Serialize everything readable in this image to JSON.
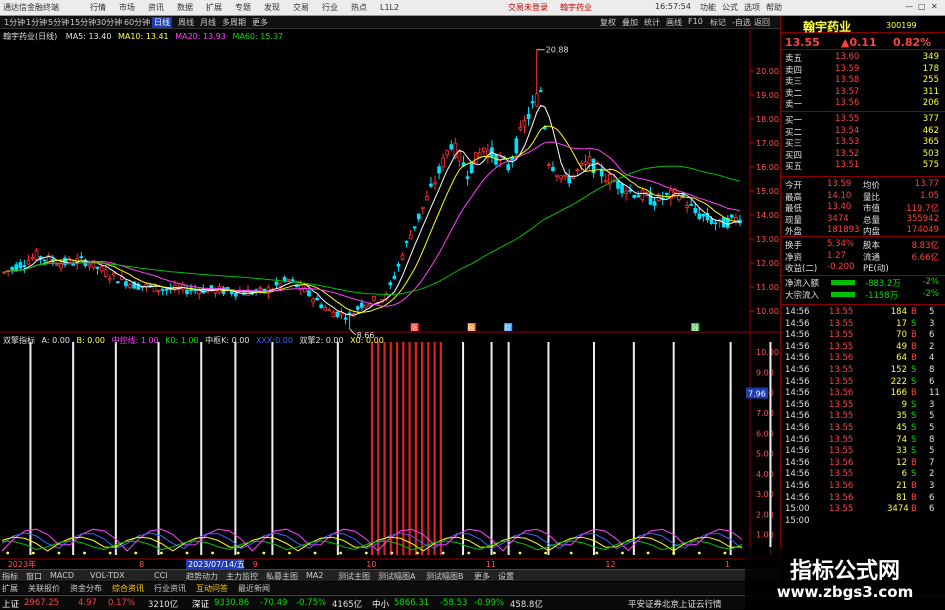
{
  "titlebar": {
    "app_title": "通达信金融终端",
    "menu": [
      "行情",
      "市场",
      "资讯",
      "数据",
      "扩展",
      "专题",
      "发现",
      "交易",
      "行业",
      "热点",
      "L1L2"
    ],
    "trade_links": "交易未登录",
    "stock_link": "翰宇药业",
    "clock": "16:57:54",
    "right_menu": [
      "功能",
      "公式",
      "选项",
      "帮助"
    ]
  },
  "toolbar": {
    "periods": [
      "1分钟",
      "1分钟",
      "5分钟",
      "15分钟",
      "30分钟",
      "60分钟",
      "日线",
      "周线",
      "月线",
      "多周期",
      "更多"
    ],
    "active": "日线",
    "right_items": [
      "复权",
      "叠加",
      "统计",
      "画线",
      "F10",
      "标记",
      "-自选",
      "返回"
    ]
  },
  "main": {
    "chart_title": "翰宇药业(日线)",
    "ma5": "MA5: 13.40",
    "ma10": "MA10: 13.41",
    "ma20": "MA20: 13.93",
    "ma60": "MA60: 15.37",
    "high_marker": "20.88",
    "low_marker": "8.66",
    "event_markers": [
      "涨",
      "融",
      "财",
      "融"
    ],
    "indicator_title": "双擎指标",
    "ind_a": "A: 0.00",
    "ind_b": "B: 0.00",
    "ind_zhongkong": "中控线: 1.00",
    "ind_k0": "K0: 1.00",
    "ind_zhongfu": "中枢K: 0.00",
    "ind_x": "XXX:0.00",
    "ind_shuangqing2": "双擎2: 0.00",
    "ind_x0": "X0: 0.00",
    "price_axis": [
      "20.00",
      "19.00",
      "18.00",
      "17.00",
      "16.00",
      "15.00",
      "14.00",
      "13.00",
      "12.00",
      "11.00",
      "10.00"
    ],
    "ind_axis": [
      "10.00",
      "9.00",
      "8.00",
      "7.00",
      "6.00",
      "5.00",
      "4.00",
      "3.00",
      "2.00",
      "1.00"
    ],
    "ind_badge": "7.96",
    "date_axis": [
      "2023年",
      "8",
      "9",
      "10",
      "11",
      "12",
      "1"
    ],
    "date_cursor": "2023/07/14/五",
    "low_price_bubble": "8.66"
  },
  "tabs": [
    "指标",
    "窗口",
    "MACD",
    "VOL-TDX",
    "CCI",
    "趋势动力",
    "主力监控",
    "私募主图",
    "MA2",
    "测试主图",
    "测试幅图A",
    "测试幅图B",
    "更多",
    "设置"
  ],
  "subtabs": [
    "扩展",
    "关联报价",
    "资金分布",
    "综合资讯",
    "行业资讯",
    "互动问答",
    "最近新闻"
  ],
  "right_panel": {
    "stock_name": "翰宇药业",
    "stock_code": "300199",
    "price": "13.55",
    "change": "▲0.11",
    "change_pct": "0.82%",
    "asks": [
      {
        "label": "卖五",
        "price": "13.60",
        "vol": "349"
      },
      {
        "label": "卖四",
        "price": "13.59",
        "vol": "178"
      },
      {
        "label": "卖三",
        "price": "13.58",
        "vol": "255"
      },
      {
        "label": "卖二",
        "price": "13.57",
        "vol": "311"
      },
      {
        "label": "卖一",
        "price": "13.56",
        "vol": "206"
      }
    ],
    "bids": [
      {
        "label": "买一",
        "price": "13.55",
        "vol": "377"
      },
      {
        "label": "买二",
        "price": "13.54",
        "vol": "462"
      },
      {
        "label": "买三",
        "price": "13.53",
        "vol": "365"
      },
      {
        "label": "买四",
        "price": "13.52",
        "vol": "503"
      },
      {
        "label": "买五",
        "price": "13.51",
        "vol": "575"
      }
    ],
    "stats": [
      {
        "k1": "今开",
        "v1": "13.59",
        "k2": "均价",
        "v2": "13.77"
      },
      {
        "k1": "最高",
        "v1": "14.10",
        "k2": "量比",
        "v2": "1.05"
      },
      {
        "k1": "最低",
        "v1": "13.40",
        "k2": "市值",
        "v2": "119.7亿"
      },
      {
        "k1": "现量",
        "v1": "3474",
        "k2": "总量",
        "v2": "355942"
      },
      {
        "k1": "外盘",
        "v1": "181893",
        "k2": "内盘",
        "v2": "174049"
      }
    ],
    "stats2": [
      {
        "k1": "换手",
        "v1": "5.34%",
        "k2": "股本",
        "v2": "8.83亿"
      },
      {
        "k1": "净资",
        "v1": "1.27",
        "k2": "流通",
        "v2": "6.66亿"
      },
      {
        "k1": "收益(二)",
        "v1": "-0.200",
        "k2": "PE(动)",
        "v2": ""
      }
    ],
    "flows": [
      {
        "label": "净流入额",
        "value": "-883.2万",
        "pct": "-2%"
      },
      {
        "label": "大宗流入",
        "value": "-1158万",
        "pct": "-2%"
      }
    ],
    "ticks": [
      {
        "t": "14:56",
        "p": "13.55",
        "v": "184",
        "d": "B",
        "n": "5"
      },
      {
        "t": "14:56",
        "p": "13.55",
        "v": "17",
        "d": "S",
        "n": "3"
      },
      {
        "t": "14:56",
        "p": "13.55",
        "v": "70",
        "d": "B",
        "n": "6"
      },
      {
        "t": "14:56",
        "p": "13.55",
        "v": "49",
        "d": "B",
        "n": "2"
      },
      {
        "t": "14:56",
        "p": "13.56",
        "v": "64",
        "d": "B",
        "n": "4"
      },
      {
        "t": "14:56",
        "p": "13.55",
        "v": "152",
        "d": "S",
        "n": "8"
      },
      {
        "t": "14:56",
        "p": "13.55",
        "v": "222",
        "d": "S",
        "n": "6"
      },
      {
        "t": "14:56",
        "p": "13.56",
        "v": "166",
        "d": "B",
        "n": "11"
      },
      {
        "t": "14:56",
        "p": "13.55",
        "v": "9",
        "d": "S",
        "n": "3"
      },
      {
        "t": "14:56",
        "p": "13.55",
        "v": "35",
        "d": "S",
        "n": "5"
      },
      {
        "t": "14:56",
        "p": "13.55",
        "v": "45",
        "d": "S",
        "n": "5"
      },
      {
        "t": "14:56",
        "p": "13.55",
        "v": "74",
        "d": "S",
        "n": "8"
      },
      {
        "t": "14:56",
        "p": "13.55",
        "v": "33",
        "d": "S",
        "n": "5"
      },
      {
        "t": "14:56",
        "p": "13.56",
        "v": "12",
        "d": "B",
        "n": "7"
      },
      {
        "t": "14:56",
        "p": "13.55",
        "v": "6",
        "d": "S",
        "n": "2"
      },
      {
        "t": "14:56",
        "p": "13.56",
        "v": "21",
        "d": "B",
        "n": "3"
      },
      {
        "t": "14:56",
        "p": "13.56",
        "v": "81",
        "d": "B",
        "n": "6"
      },
      {
        "t": "15:00",
        "p": "13.55",
        "v": "3474",
        "d": "B",
        "n": "6"
      },
      {
        "t": "15:00",
        "p": "",
        "v": "",
        "d": "",
        "n": ""
      }
    ]
  },
  "ticker": {
    "sh_label": "上证",
    "sh_val": "2967.25",
    "sh_chg": "4.97",
    "sh_pct": "0.17%",
    "sh_amt": "3210亿",
    "sz_label": "深证",
    "sz_val": "9330.86",
    "sz_chg": "-70.49",
    "sz_pct": "-0.75%",
    "sz_amt": "4165亿",
    "zx_label": "中小",
    "zx_val": "5866.31",
    "zx_chg": "-58.53",
    "zx_pct": "-0.99%",
    "zx_amt": "458.8亿",
    "broker": "平安证券北京上证云行情"
  },
  "watermark": {
    "title": "指标公式网",
    "url": "www.zbgs3.com"
  },
  "colors": {
    "up": "#ff3030",
    "down": "#00e0ff",
    "ma5": "#ffffff",
    "ma10": "#ffff00",
    "ma20": "#ff40ff",
    "ma60": "#00c000",
    "accent": "#1e3cb0"
  }
}
